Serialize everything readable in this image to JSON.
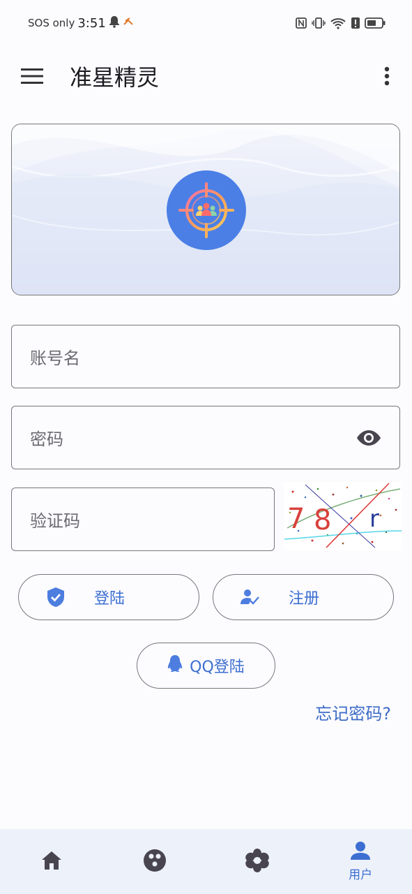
{
  "status_bar": {
    "carrier": "SOS only",
    "time": "3:51"
  },
  "app_bar": {
    "title": "准星精灵"
  },
  "form": {
    "username_placeholder": "账号名",
    "password_placeholder": "密码",
    "captcha_placeholder": "验证码",
    "captcha_chars": [
      "7",
      "8",
      "r"
    ]
  },
  "buttons": {
    "login": "登陆",
    "register": "注册",
    "qq_login": "QQ登陆",
    "forgot_password": "忘记密码?"
  },
  "bottom_nav": {
    "items": [
      {
        "icon": "home-icon",
        "label": ""
      },
      {
        "icon": "game-icon",
        "label": ""
      },
      {
        "icon": "flower-icon",
        "label": ""
      },
      {
        "icon": "user-icon",
        "label": "用户"
      }
    ],
    "active_index": 3
  },
  "colors": {
    "accent": "#3c6fd1",
    "logo_bg": "#4b7fe6",
    "nav_bg": "#edf1fa"
  }
}
